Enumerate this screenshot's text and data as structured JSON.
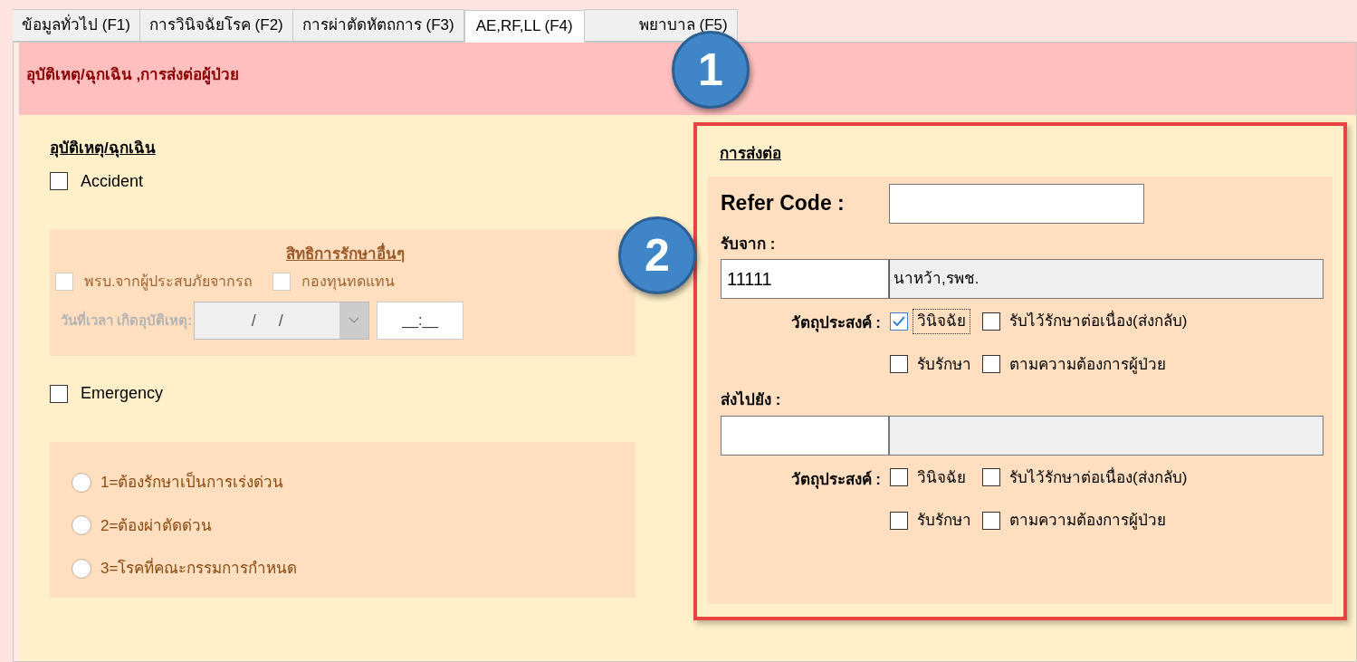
{
  "tabs": [
    {
      "label": "ข้อมูลทั่วไป (F1)",
      "selected": false
    },
    {
      "label": "การวินิจฉัยโรค (F2)",
      "selected": false
    },
    {
      "label": "การผ่าตัดหัตถการ (F3)",
      "selected": false
    },
    {
      "label": "AE,RF,LL (F4)",
      "selected": true
    },
    {
      "label": "พยาบาล (F5)",
      "selected": false
    }
  ],
  "header": {
    "title": "อุบัติเหตุ/ฉุกเฉิน ,การส่งต่อผู้ป่วย"
  },
  "accident": {
    "title": "อุบัติเหตุ/ฉุกเฉิน",
    "accident_checkbox": {
      "label": "Accident",
      "checked": false
    },
    "other_rights": {
      "title": "สิทธิการรักษาอื่นๆ",
      "disabled": true,
      "options": [
        {
          "label": "พรบ.จากผู้ประสบภัยจากรถ",
          "checked": false
        },
        {
          "label": "กองทุนทดแทน",
          "checked": false
        }
      ],
      "date_label": "วันที่เวลา เกิดอุบัติเหตุ:",
      "date_value": "/     /",
      "time_value": "__:__"
    },
    "emergency_checkbox": {
      "label": "Emergency",
      "checked": false
    },
    "urgency": [
      {
        "label": "1=ต้องรักษาเป็นการเร่งด่วน",
        "selected": false
      },
      {
        "label": "2=ต้องผ่าตัดด่วน",
        "selected": false
      },
      {
        "label": "3=โรคที่คณะกรรมการกำหนด",
        "selected": false
      }
    ]
  },
  "referral": {
    "title": "การส่งต่อ",
    "highlighted": true,
    "refer_code_label": "Refer Code :",
    "receive_from": {
      "label": "รับจาก :",
      "code": "11111",
      "name": "นาหว้า,รพช.",
      "purpose_label": "วัตถุประสงค์ :",
      "purposes": [
        {
          "label": "วินิจฉัย",
          "checked": true,
          "focused": true
        },
        {
          "label": "รับไว้รักษาต่อเนื่อง(ส่งกลับ)",
          "checked": false,
          "focused": false
        },
        {
          "label": "รับรักษา",
          "checked": false,
          "focused": false
        },
        {
          "label": "ตามความต้องการผู้ป่วย",
          "checked": false,
          "focused": false
        }
      ]
    },
    "send_to": {
      "label": "ส่งไปยัง :",
      "purpose_label": "วัตถุประสงค์ :",
      "purposes": [
        {
          "label": "วินิจฉัย",
          "checked": false,
          "focused": false
        },
        {
          "label": "รับไว้รักษาต่อเนื่อง(ส่งกลับ)",
          "checked": false,
          "focused": false
        },
        {
          "label": "รับรักษา",
          "checked": false,
          "focused": false
        },
        {
          "label": "ตามความต้องการผู้ป่วย",
          "checked": false,
          "focused": false
        }
      ]
    }
  },
  "annotations": [
    {
      "number": "1"
    },
    {
      "number": "2"
    }
  ]
}
